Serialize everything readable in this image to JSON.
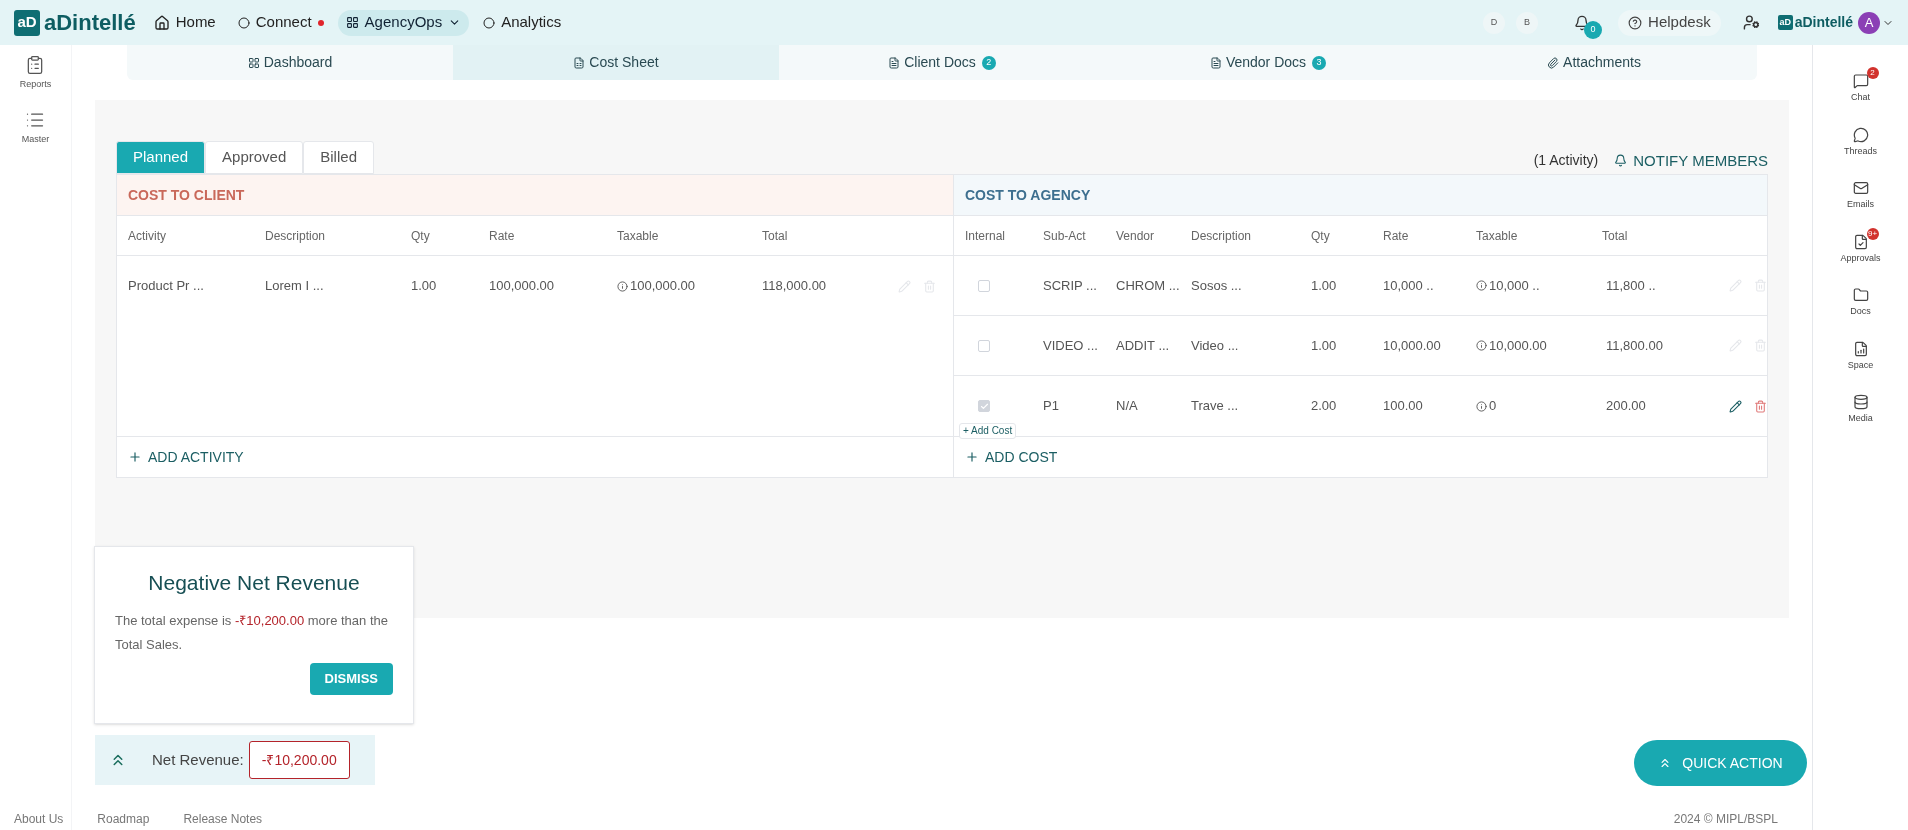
{
  "topbar": {
    "logo_mark": "aD",
    "logo_text": "aDintellé",
    "nav": [
      {
        "label": "Home",
        "kind": "home",
        "selected": false,
        "dot": false,
        "caret": false
      },
      {
        "label": "Connect",
        "kind": "connect",
        "selected": false,
        "dot": true,
        "caret": false
      },
      {
        "label": "AgencyOps",
        "kind": "grid",
        "selected": true,
        "dot": false,
        "caret": true
      },
      {
        "label": "Analytics",
        "kind": "connect",
        "selected": false,
        "dot": false,
        "caret": false
      }
    ],
    "mini_buttons": [
      "D",
      "B"
    ],
    "bell_badge": "0",
    "helpdesk": "Helpdesk",
    "brand_mark": "aD",
    "brand_text": "aDintellé",
    "avatar": "A"
  },
  "left_sidebar": [
    {
      "label": "Reports",
      "kind": "clipboard"
    },
    {
      "label": "Master",
      "kind": "list"
    }
  ],
  "subtabs": [
    {
      "label": "Dashboard",
      "kind": "grid",
      "selected": false
    },
    {
      "label": "Cost Sheet",
      "kind": "sheet",
      "selected": true
    },
    {
      "label": "Client Docs",
      "kind": "doc",
      "selected": false,
      "count": "2"
    },
    {
      "label": "Vendor Docs",
      "kind": "doc",
      "selected": false,
      "count": "3"
    },
    {
      "label": "Attachments",
      "kind": "clip",
      "selected": false
    }
  ],
  "status_tabs": [
    {
      "label": "Planned",
      "selected": true
    },
    {
      "label": "Approved",
      "selected": false
    },
    {
      "label": "Billed",
      "selected": false
    }
  ],
  "activity_count": "(1 Activity)",
  "notify": "NOTIFY MEMBERS",
  "client": {
    "title": "COST TO CLIENT",
    "columns": [
      "Activity",
      "Description",
      "Qty",
      "Rate",
      "Taxable",
      "Total"
    ],
    "rows": [
      {
        "activity": "Product Pr ...",
        "description": "Lorem I ...",
        "qty": "1.00",
        "rate": "100,000.00",
        "taxable": "100,000.00",
        "total": "118,000.00",
        "disabled": true
      }
    ],
    "add": "ADD ACTIVITY"
  },
  "agency": {
    "title": "COST TO AGENCY",
    "columns": [
      "Internal",
      "Sub-Act",
      "Vendor",
      "Description",
      "Qty",
      "Rate",
      "Taxable",
      "Total"
    ],
    "rows": [
      {
        "checked": false,
        "sub_act": "SCRIP ...",
        "vendor": "CHROM ...",
        "description": "Sosos ...",
        "qty": "1.00",
        "rate": "10,000 ..",
        "taxable": "10,000 ..",
        "total": "11,800 ..",
        "disabled": true
      },
      {
        "checked": false,
        "sub_act": "VIDEO ...",
        "vendor": "ADDIT ...",
        "description": "Video ...",
        "qty": "1.00",
        "rate": "10,000.00",
        "taxable": "10,000.00",
        "total": "11,800.00",
        "disabled": true
      },
      {
        "checked": true,
        "sub_act": "P1",
        "vendor": "N/A",
        "description": "Trave ...",
        "qty": "2.00",
        "rate": "100.00",
        "taxable": "0",
        "total": "200.00",
        "disabled": false
      }
    ],
    "add_chip": "+ Add Cost",
    "add": "ADD COST"
  },
  "popup": {
    "title": "Negative Net Revenue",
    "message_start": "The total expense is",
    "amount": "-₹10,200.00",
    "message_end": "more than the Total Sales.",
    "button": "DISMISS"
  },
  "net_revenue": {
    "label": "Net Revenue:",
    "value": "-₹10,200.00"
  },
  "quick_action": "QUICK ACTION",
  "right_sidebar": [
    {
      "label": "Chat",
      "kind": "chat",
      "badge": "2"
    },
    {
      "label": "Threads",
      "kind": "thread"
    },
    {
      "label": "Emails",
      "kind": "mail"
    },
    {
      "label": "Approvals",
      "kind": "approval",
      "badge": "9+"
    },
    {
      "label": "Docs",
      "kind": "folder"
    },
    {
      "label": "Space",
      "kind": "chart"
    },
    {
      "label": "Media",
      "kind": "db"
    }
  ],
  "footer": {
    "links": [
      "About Us",
      "Roadmap",
      "Release Notes"
    ],
    "copyright": "2024 © MIPL/BSPL"
  }
}
